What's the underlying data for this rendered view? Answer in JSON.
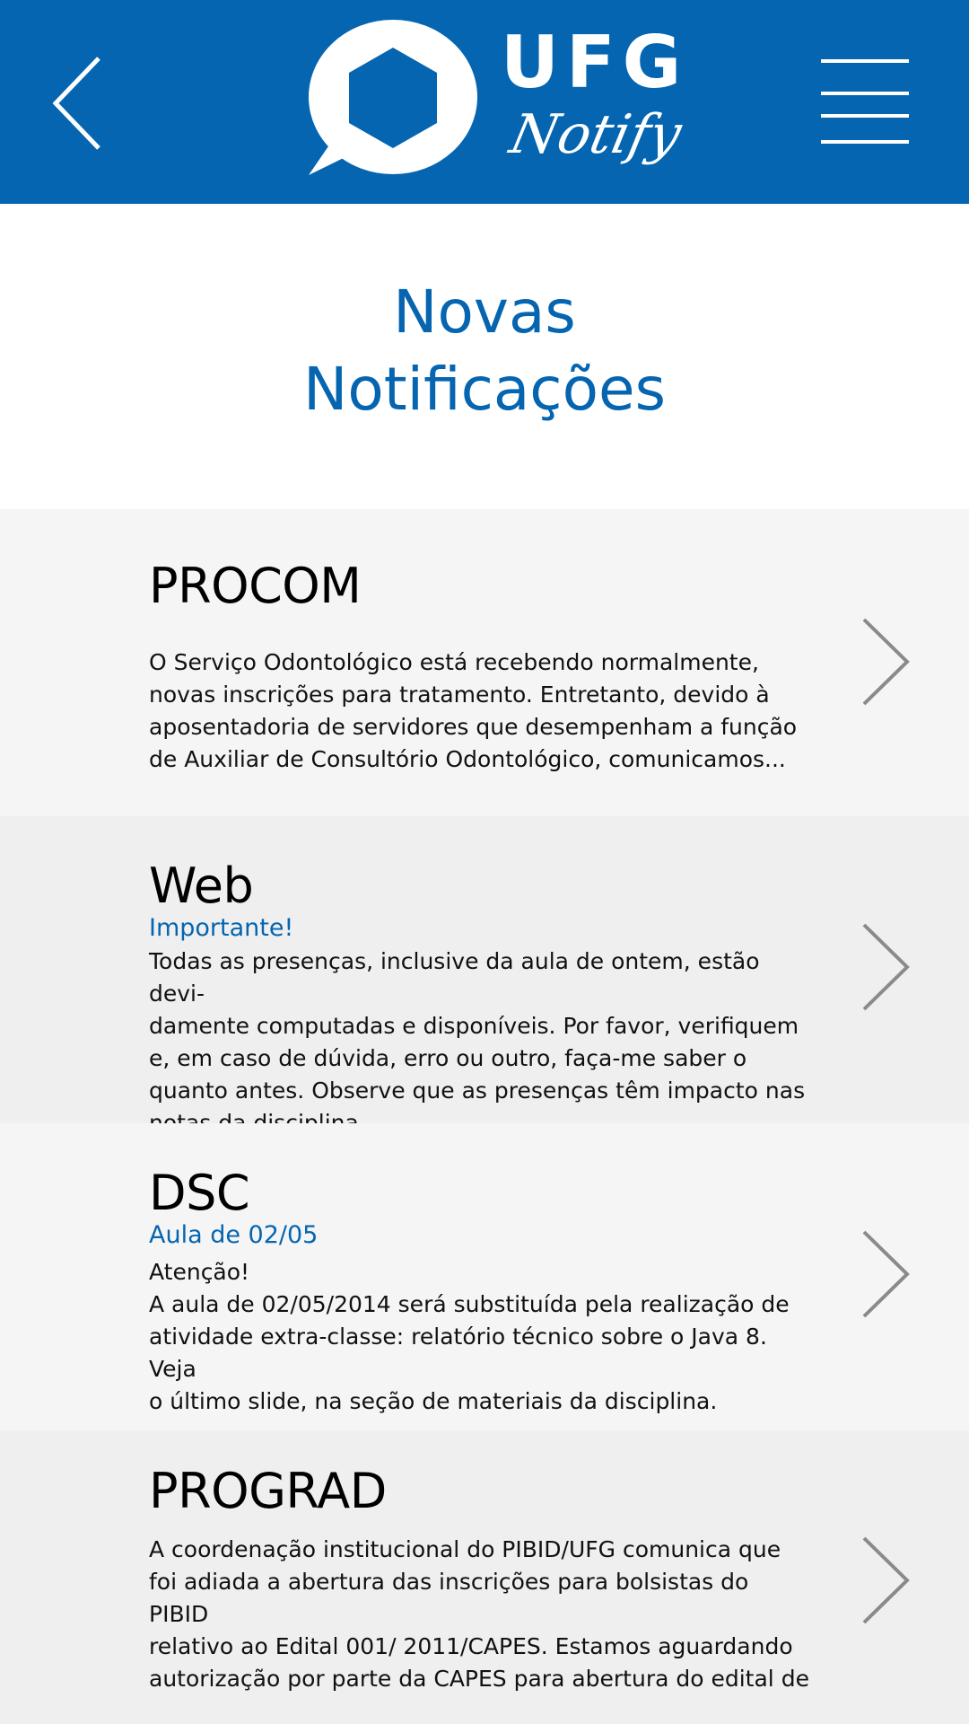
{
  "header": {
    "logo_text": "UFG",
    "logo_subtext": "Notify",
    "back_icon": "chevron-left-icon",
    "menu_icon": "hamburger-menu-icon",
    "background_color": "#0565b0"
  },
  "page": {
    "title_line1": "Novas",
    "title_line2": "Notificações"
  },
  "notifications": [
    {
      "title": "PROCOM",
      "subtitle": "",
      "body": "O Serviço Odontológico está recebendo normalmente,\nnovas inscrições para tratamento. Entretanto, devido à\naposentadoria de servidores que desempenham a função\nde Auxiliar de Consultório Odontológico, comunicamos..."
    },
    {
      "title": "Web",
      "subtitle": "Importante!",
      "body": "Todas as presenças, inclusive da aula de ontem, estão devi-\ndamente computadas e disponíveis. Por favor, verifiquem\ne, em caso de dúvida, erro ou outro, faça-me saber o\nquanto antes. Observe que as presenças têm impacto nas\nnotas da disciplina."
    },
    {
      "title": "DSC",
      "subtitle": "Aula de 02/05",
      "body": "Atenção!\nA aula de 02/05/2014 será substituída pela realização de\natividade extra-classe: relatório técnico sobre o Java 8. Veja\no último slide, na seção de materiais da disciplina."
    },
    {
      "title": "PROGRAD",
      "subtitle": "",
      "body": "A coordenação institucional do PIBID/UFG comunica que\nfoi adiada a abertura das inscrições para bolsistas do PIBID\nrelativo ao Edital 001/ 2011/CAPES. Estamos aguardando\nautorização por parte da CAPES para abertura do edital de"
    }
  ],
  "colors": {
    "accent": "#0565b0",
    "card_light": "#f5f5f5",
    "card_dark": "#efefef",
    "chevron": "#8a8a8a"
  }
}
